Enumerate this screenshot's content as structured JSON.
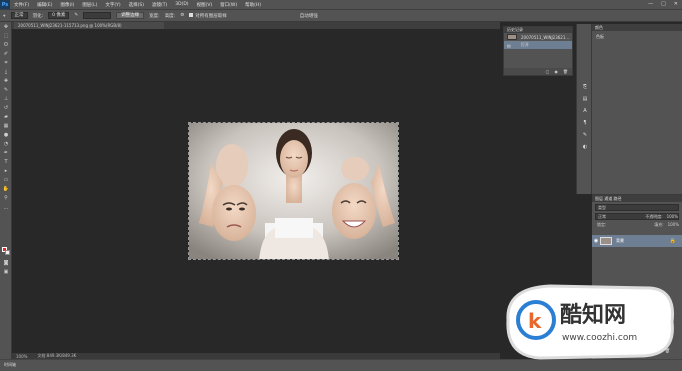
{
  "app": {
    "logo": "Ps"
  },
  "menu": [
    "文件(F)",
    "编辑(E)",
    "图像(I)",
    "图层(L)",
    "文字(Y)",
    "选择(S)",
    "滤镜(T)",
    "3D(D)",
    "视图(V)",
    "窗口(W)",
    "帮助(H)"
  ],
  "window_controls": {
    "minimize": "—",
    "maximize": "□",
    "close": "✕"
  },
  "options": {
    "mode_value": "正常",
    "feather_label": "羽化:",
    "feather_value": "0 像素",
    "refine_button": "调整边缘",
    "sample_all_label": "对所有图层取样",
    "width_label": "宽度:",
    "height_label": "高度:",
    "auto_enhance_label": "自动增强"
  },
  "document": {
    "tab_title": "20070511_WINJ23621-115713.png @ 100%(RGB/8)"
  },
  "status": {
    "zoom": "100%",
    "doc_info": "文档:849.3K/849.3K"
  },
  "timeline_label": "时间轴",
  "history": {
    "tab": "历史记录",
    "rows": [
      {
        "label": "20070511_WINJ23621..."
      },
      {
        "label": "打开"
      }
    ]
  },
  "right_panel": {
    "tab": "颜色",
    "sub": "色板"
  },
  "layers": {
    "tabs": "图层  通道  路径",
    "kind_value": "类型",
    "blend_value": "正常",
    "opacity_label": "不透明度:",
    "opacity_value": "100%",
    "lock_label": "锁定:",
    "fill_label": "填充:",
    "fill_value": "100%",
    "layer_name": "背景",
    "footer_icons": [
      "∞",
      "fx",
      "◐",
      "▢",
      "▭",
      "▤",
      "🗑"
    ]
  },
  "watermark": {
    "brand": "酷知网",
    "url": "www.coozhi.com"
  },
  "colors": {
    "foreground": "#e0282a",
    "background": "#f2f2f2",
    "selected": "#6f7f93"
  }
}
